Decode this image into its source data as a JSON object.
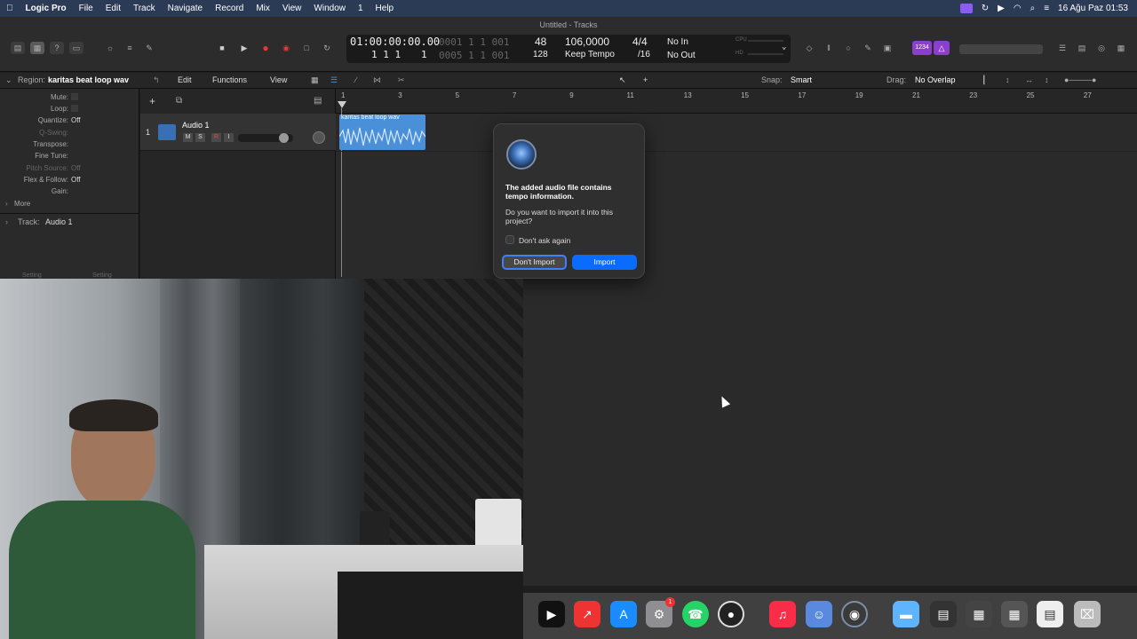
{
  "menubar": {
    "apple": "",
    "app": "Logic Pro",
    "items": [
      "File",
      "Edit",
      "Track",
      "Navigate",
      "Record",
      "Mix",
      "View",
      "Window",
      "1",
      "Help"
    ],
    "datetime": "16 Ağu Paz  01:53"
  },
  "window": {
    "title": "Untitled - Tracks"
  },
  "lcd": {
    "time": "01:00:00:00.00",
    "time_dim": "0001 1 1 001",
    "bars": "1  1  1",
    "bars_sub": "1",
    "bars_dim": "0005 1 1 001",
    "tempo_a": "48",
    "tempo_b": "128",
    "bpm": "106,0000",
    "keep_tempo": "Keep Tempo",
    "sig": "4/4",
    "div": "/16",
    "in": "No In",
    "out": "No Out",
    "cpu": "CPU",
    "hd": "HD"
  },
  "editbar": {
    "region_label": "Region:",
    "region_name": "karitas beat loop wav",
    "edit": "Edit",
    "functions": "Functions",
    "view": "View",
    "snap_label": "Snap:",
    "snap_value": "Smart",
    "drag_label": "Drag:",
    "drag_value": "No Overlap"
  },
  "inspector": {
    "rows": [
      {
        "k": "Mute:",
        "v": ""
      },
      {
        "k": "Loop:",
        "v": ""
      },
      {
        "k": "Quantize:",
        "v": "Off"
      },
      {
        "k": "Q-Swing:",
        "v": ""
      },
      {
        "k": "Transpose:",
        "v": ""
      },
      {
        "k": "Fine Tune:",
        "v": ""
      },
      {
        "k": "Pitch Source:",
        "v": "Off"
      },
      {
        "k": "Flex & Follow:",
        "v": "Off"
      },
      {
        "k": "Gain:",
        "v": ""
      }
    ],
    "more": "More",
    "track_label": "Track:",
    "track_name": "Audio 1",
    "setting_a": "Setting",
    "setting_b": "Setting"
  },
  "track": {
    "number": "1",
    "name": "Audio 1",
    "m": "M",
    "s": "S",
    "r": "R",
    "i": "I",
    "volume_fraction": 0.82
  },
  "ruler": [
    "1",
    "3",
    "5",
    "7",
    "9",
    "11",
    "13",
    "15",
    "17",
    "19",
    "21",
    "23",
    "25",
    "27"
  ],
  "region": {
    "name": "karitas beat loop wav"
  },
  "dialog": {
    "title": "The added audio file contains tempo information.",
    "body": "Do you want to import it into this project?",
    "checkbox": "Don't ask again",
    "btn_secondary": "Don't Import",
    "btn_primary": "Import"
  },
  "dock": {
    "icons": [
      "tv-icon",
      "rocket-icon",
      "app-store-icon",
      "settings-icon",
      "whatsapp-icon",
      "obs-icon",
      "music-icon",
      "finder-icon",
      "logic-icon",
      "folder-icon"
    ],
    "settings_badge": "1"
  },
  "colors": {
    "accent": "#0a6cff",
    "region": "#4a90d9",
    "menubar": "#2b3b55"
  }
}
